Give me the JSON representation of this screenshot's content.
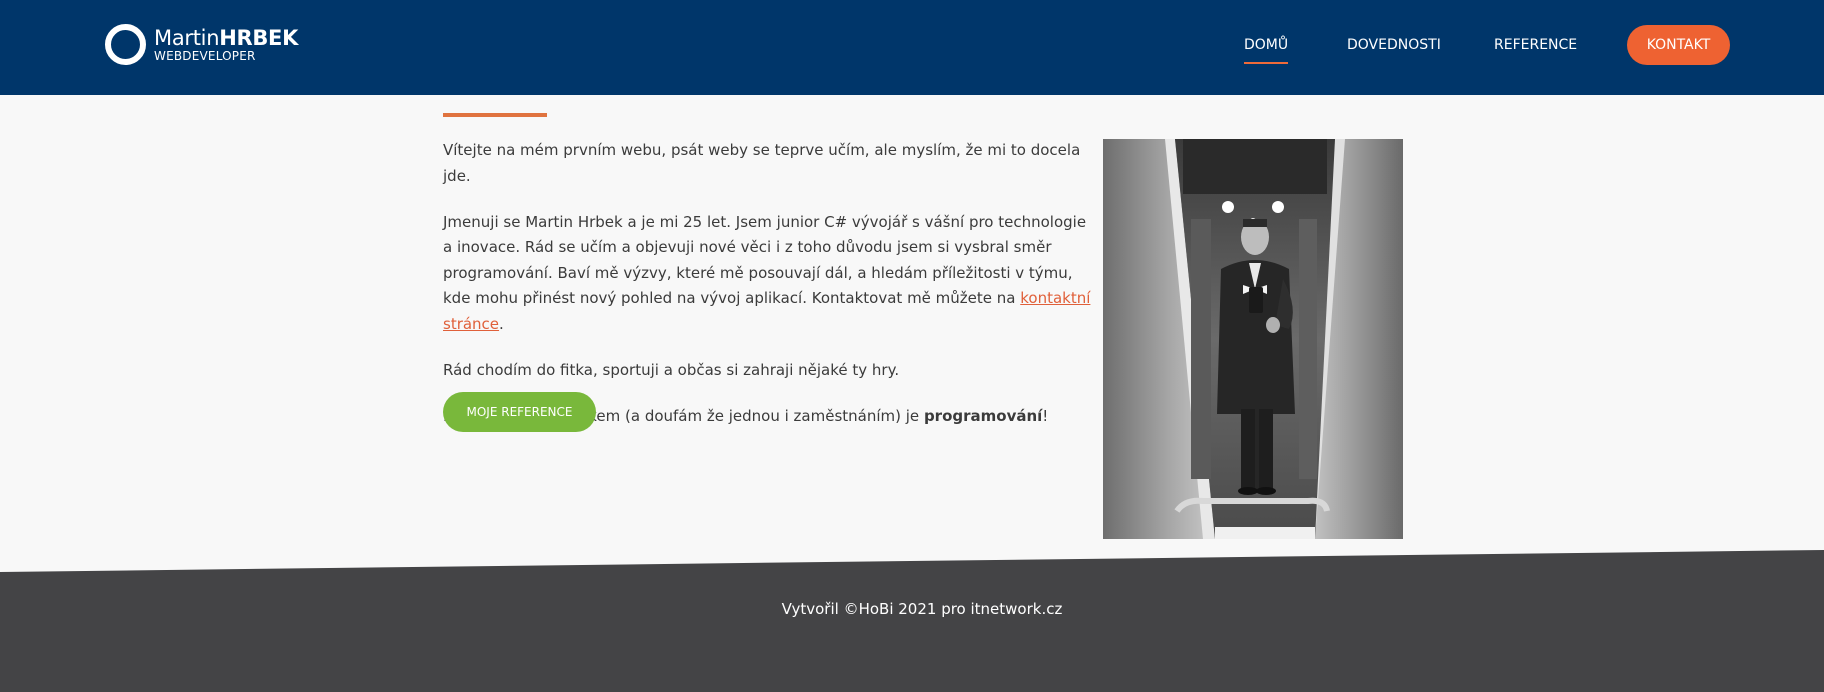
{
  "header": {
    "logo": {
      "name_regular": "Martin",
      "name_bold": "HRBEK",
      "subtitle": "WEBDEVELOPER"
    },
    "nav": [
      {
        "label": "DOMŮ",
        "active": true
      },
      {
        "label": "DOVEDNOSTI"
      },
      {
        "label": "REFERENCE"
      }
    ],
    "cta_label": "KONTAKT"
  },
  "main": {
    "paragraphs": {
      "p1": "Vítejte na mém prvním webu, psát weby se teprve učím, ale myslím, že mi to docela jde.",
      "p2_text": "Jmenuji se Martin Hrbek a je mi 25 let. Jsem junior C# vývojář s vášní pro technologie a inovace. Rád se učím a objevuji nové věci i z toho důvodu jsem si vysbral směr programování. Baví mě výzvy, které mě posouvají dál, a hledám příležitosti v týmu, kde mohu přinést nový pohled na vývoj aplikací. Kontaktovat mě můžete na ",
      "p2_link": "kontaktní stránce",
      "p2_end": ".",
      "p3": "Rád chodím do fitka, sportuji a občas si zahraji nějaké ty hry.",
      "p4_text": "Mým hlavním koníčkem (a doufám že jednou i zaměstnáním) je ",
      "p4_bold": "programování",
      "p4_end": "!"
    },
    "button_label": "MOJE REFERENCE"
  },
  "footer": {
    "text": "Vytvořil ©HoBi 2021 pro itnetwork.cz"
  },
  "colors": {
    "header_bg": "#00366a",
    "accent_orange": "#ee6232",
    "button_green": "#79b83b",
    "footer_bg": "#444446",
    "page_bg": "#f8f8f8"
  }
}
